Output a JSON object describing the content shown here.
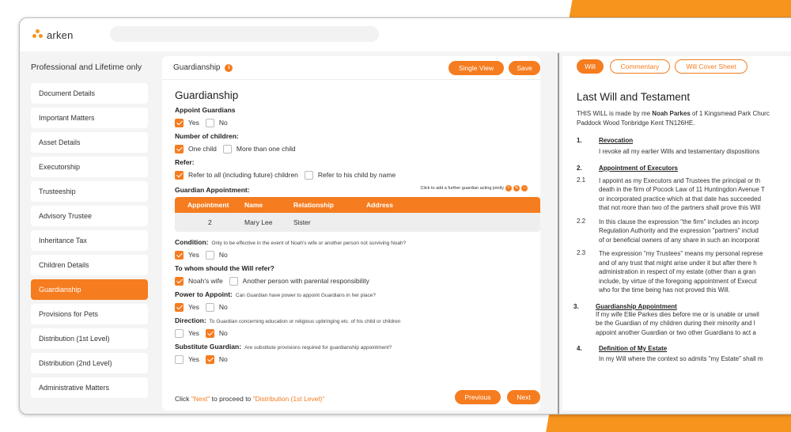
{
  "app": {
    "logo_text": "arken"
  },
  "sidebar": {
    "title": "Professional and Lifetime only",
    "items": [
      {
        "label": "Document Details"
      },
      {
        "label": "Important Matters"
      },
      {
        "label": "Asset Details"
      },
      {
        "label": "Executorship"
      },
      {
        "label": "Trusteeship"
      },
      {
        "label": "Advisory Trustee"
      },
      {
        "label": "Inheritance Tax"
      },
      {
        "label": "Children Details"
      },
      {
        "label": "Guardianship",
        "active": true
      },
      {
        "label": "Provisions for Pets"
      },
      {
        "label": "Distribution (1st Level)"
      },
      {
        "label": "Distribution (2nd Level)"
      },
      {
        "label": "Administrative Matters"
      }
    ]
  },
  "panel": {
    "header_title": "Guardianship",
    "single_view_label": "Single View",
    "save_label": "Save",
    "heading": "Guardianship",
    "appoint": {
      "label": "Appoint Guardians",
      "yes": "Yes",
      "no": "No"
    },
    "children": {
      "label": "Number of children:",
      "one": "One child",
      "more": "More than one child"
    },
    "refer": {
      "label": "Refer:",
      "all": "Refer to all (including future) children",
      "his": "Refer to his child by name"
    },
    "appointment": {
      "label": "Guardian Appointment:",
      "hint": "Click to add a further guardian acting jointly",
      "columns": [
        "Appointment",
        "Name",
        "Relationship",
        "Address"
      ],
      "rows": [
        {
          "appointment": "2",
          "name": "Mary Lee",
          "relationship": "Sister",
          "address": ""
        }
      ]
    },
    "condition": {
      "label": "Condition:",
      "sub": "Only to be effective in the event of Noah's wife or another person not surviving Noah?",
      "yes": "Yes",
      "no": "No"
    },
    "whom": {
      "label": "To whom should the Will refer?",
      "wife": "Noah's wife",
      "other": "Another person with parental responsibility"
    },
    "power": {
      "label": "Power to Appoint:",
      "sub": "Can Guardian have power to appoint Guardians in her place?",
      "yes": "Yes",
      "no": "No"
    },
    "direction": {
      "label": "Direction:",
      "sub": "To Guardian concerning education or religious upbringing etc. of his child or children",
      "yes": "Yes",
      "no": "No"
    },
    "substitute": {
      "label": "Substitute Guardian:",
      "sub": "Are substitute provisions required for guardianship appointment?",
      "yes": "Yes",
      "no": "No"
    },
    "footer": {
      "click": "Click ",
      "next_q": "\"Next\"",
      "proceed": " to proceed to ",
      "target": "\"Distribution (1st Level)\""
    },
    "previous_label": "Previous",
    "next_label": "Next"
  },
  "right": {
    "tabs": [
      "Will",
      "Commentary",
      "Will Cover Sheet"
    ],
    "doc_title": "Last Will and Testament",
    "intro_a": "THIS WILL is made by me ",
    "intro_name": "Noah Parkes",
    "intro_b": " of 1 Kingsmead Park Churc",
    "intro_line2": "Paddock Wood Tonbridge Kent TN126HE.",
    "sections": [
      {
        "num": "1.",
        "title": "Revocation",
        "text": "I revoke all my earlier Wills and testamentary dispositions"
      },
      {
        "num": "2.",
        "title": "Appointment of Executors"
      }
    ],
    "clauses": [
      {
        "num": "2.1",
        "lines": [
          "I appoint as my Executors and Trustees the principal or th",
          "death in the firm of Pocock Law of 11 Huntingdon Avenue T",
          "or incorporated practice which at that date has succeeded",
          "that not more than two of the partners shall prove this Will"
        ]
      },
      {
        "num": "2.2",
        "lines": [
          "In this clause the expression \"the firm\" includes an incorp",
          "Regulation Authority and the expression \"partners\" includ",
          "of or beneficial owners of any share in such an incorporat"
        ]
      },
      {
        "num": "2.3",
        "lines": [
          "The expression \"my Trustees\" means my personal represe",
          "and of any trust that might arise under it but after there h",
          "administration in respect of my estate (other than a gran",
          "include, by virtue of the foregoing appointment of Execut",
          "who for the time being has not proved this Will."
        ]
      }
    ],
    "sec3": {
      "num": "3.",
      "title": "Guardianship Appointment",
      "lines": [
        "If my wife Ellie Parkes dies before me or is unable or unwil",
        "be the Guardian of my children during their minority and I",
        "appoint another Guardian or two other Guardians to act a"
      ]
    },
    "sec4": {
      "num": "4.",
      "title": "Definition of My Estate",
      "text": "In my Will where the context so admits \"my Estate\" shall m"
    }
  }
}
